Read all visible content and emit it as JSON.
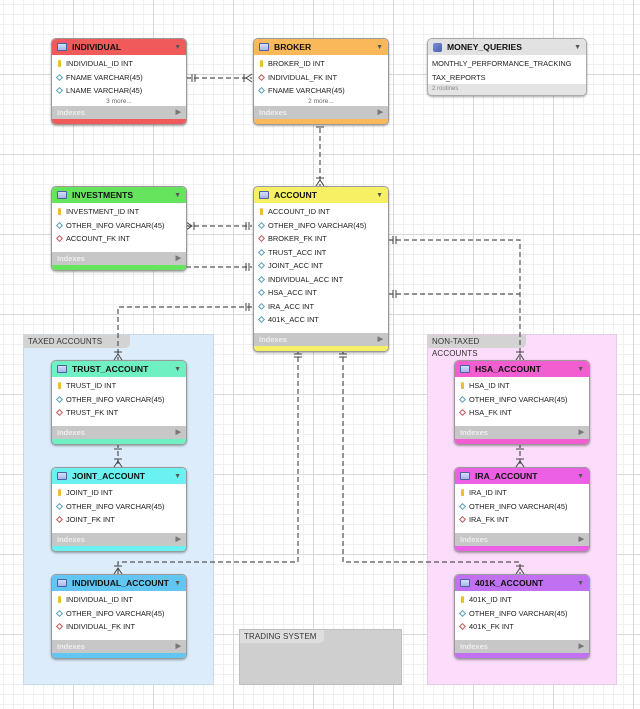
{
  "layers": {
    "taxed": {
      "title": "TAXED ACCOUNTS",
      "color": "#dcecfb"
    },
    "non_taxed": {
      "title": "NON-TAXED ACCOUNTS",
      "color": "#fbdcfa"
    },
    "trading": {
      "title": "TRADING SYSTEM",
      "color": "#cfcfcf"
    }
  },
  "tables": {
    "individual": {
      "name": "INDIVIDUAL",
      "color": "#f05a5a",
      "columns": [
        {
          "label": "INDIVIDUAL_ID INT",
          "kind": "pk"
        },
        {
          "label": "FNAME VARCHAR(45)",
          "kind": "col"
        },
        {
          "label": "LNAME VARCHAR(45)",
          "kind": "col"
        }
      ],
      "more": "3 more...",
      "indexes": "Indexes"
    },
    "broker": {
      "name": "BROKER",
      "color": "#f9b95a",
      "columns": [
        {
          "label": "BROKER_ID INT",
          "kind": "pk"
        },
        {
          "label": "INDIVIDUAL_FK INT",
          "kind": "fk"
        },
        {
          "label": "FNAME VARCHAR(45)",
          "kind": "col"
        }
      ],
      "more": "2 more...",
      "indexes": "Indexes"
    },
    "investments": {
      "name": "INVESTMENTS",
      "color": "#66e45e",
      "columns": [
        {
          "label": "INVESTMENT_ID INT",
          "kind": "pk"
        },
        {
          "label": "OTHER_INFO VARCHAR(45)",
          "kind": "col"
        },
        {
          "label": "ACCOUNT_FK INT",
          "kind": "fk"
        }
      ],
      "indexes": "Indexes"
    },
    "account": {
      "name": "ACCOUNT",
      "color": "#f7f064",
      "columns": [
        {
          "label": "ACCOUNT_ID INT",
          "kind": "pk"
        },
        {
          "label": "OTHER_INFO VARCHAR(45)",
          "kind": "col"
        },
        {
          "label": "BROKER_FK INT",
          "kind": "fk"
        },
        {
          "label": "TRUST_ACC INT",
          "kind": "col"
        },
        {
          "label": "JOINT_ACC INT",
          "kind": "col"
        },
        {
          "label": "INDIVIDUAL_ACC INT",
          "kind": "col"
        },
        {
          "label": "HSA_ACC INT",
          "kind": "col"
        },
        {
          "label": "IRA_ACC INT",
          "kind": "col"
        },
        {
          "label": "401K_ACC INT",
          "kind": "col"
        }
      ],
      "indexes": "Indexes"
    },
    "trust_account": {
      "name": "TRUST_ACCOUNT",
      "color": "#6ef0c2",
      "columns": [
        {
          "label": "TRUST_ID INT",
          "kind": "pk"
        },
        {
          "label": "OTHER_INFO VARCHAR(45)",
          "kind": "col"
        },
        {
          "label": "TRUST_FK INT",
          "kind": "fk"
        }
      ],
      "indexes": "Indexes"
    },
    "joint_account": {
      "name": "JOINT_ACCOUNT",
      "color": "#6af2f2",
      "columns": [
        {
          "label": "JOINT_ID INT",
          "kind": "pk"
        },
        {
          "label": "OTHER_INFO VARCHAR(45)",
          "kind": "col"
        },
        {
          "label": "JOINT_FK INT",
          "kind": "fk"
        }
      ],
      "indexes": "Indexes"
    },
    "individual_account": {
      "name": "INDIVIDUAL_ACCOUNT",
      "color": "#62c6f2",
      "columns": [
        {
          "label": "INDIVIDUAL_ID INT",
          "kind": "pk"
        },
        {
          "label": "OTHER_INFO VARCHAR(45)",
          "kind": "col"
        },
        {
          "label": "INDIVIDUAL_FK INT",
          "kind": "fk"
        }
      ],
      "indexes": "Indexes"
    },
    "hsa_account": {
      "name": "HSA_ACCOUNT",
      "color": "#f25ed0",
      "columns": [
        {
          "label": "HSA_ID INT",
          "kind": "pk"
        },
        {
          "label": "OTHER_INFO VARCHAR(45)",
          "kind": "col"
        },
        {
          "label": "HSA_FK INT",
          "kind": "fk"
        }
      ],
      "indexes": "Indexes"
    },
    "ira_account": {
      "name": "IRA_ACCOUNT",
      "color": "#ec60e6",
      "columns": [
        {
          "label": "IRA_ID INT",
          "kind": "pk"
        },
        {
          "label": "OTHER_INFO VARCHAR(45)",
          "kind": "col"
        },
        {
          "label": "IRA_FK INT",
          "kind": "fk"
        }
      ],
      "indexes": "Indexes"
    },
    "k401_account": {
      "name": "401K_ACCOUNT",
      "color": "#c070f0",
      "columns": [
        {
          "label": "401K_ID INT",
          "kind": "pk"
        },
        {
          "label": "OTHER_INFO VARCHAR(45)",
          "kind": "col"
        },
        {
          "label": "401K_FK INT",
          "kind": "fk"
        }
      ],
      "indexes": "Indexes"
    }
  },
  "routine_group": {
    "name": "MONEY_QUERIES",
    "routines": [
      "MONTHLY_PERFORMANCE_TRACKING",
      "TAX_REPORTS"
    ],
    "count": "2 routines"
  },
  "relationships": [
    {
      "from": "individual",
      "to": "broker",
      "type": "one-to-many"
    },
    {
      "from": "broker",
      "to": "account",
      "type": "one-to-many"
    },
    {
      "from": "account",
      "to": "investments",
      "type": "one-to-many"
    },
    {
      "from": "account",
      "to": "trust_account",
      "type": "one-to-many"
    },
    {
      "from": "trust_account",
      "to": "joint_account",
      "type": "one-to-many"
    },
    {
      "from": "account",
      "to": "individual_account",
      "type": "one-to-many"
    },
    {
      "from": "account",
      "to": "hsa_account",
      "type": "one-to-many"
    },
    {
      "from": "hsa_account",
      "to": "ira_account",
      "type": "one-to-many"
    },
    {
      "from": "account",
      "to": "k401_account",
      "type": "one-to-many"
    }
  ]
}
